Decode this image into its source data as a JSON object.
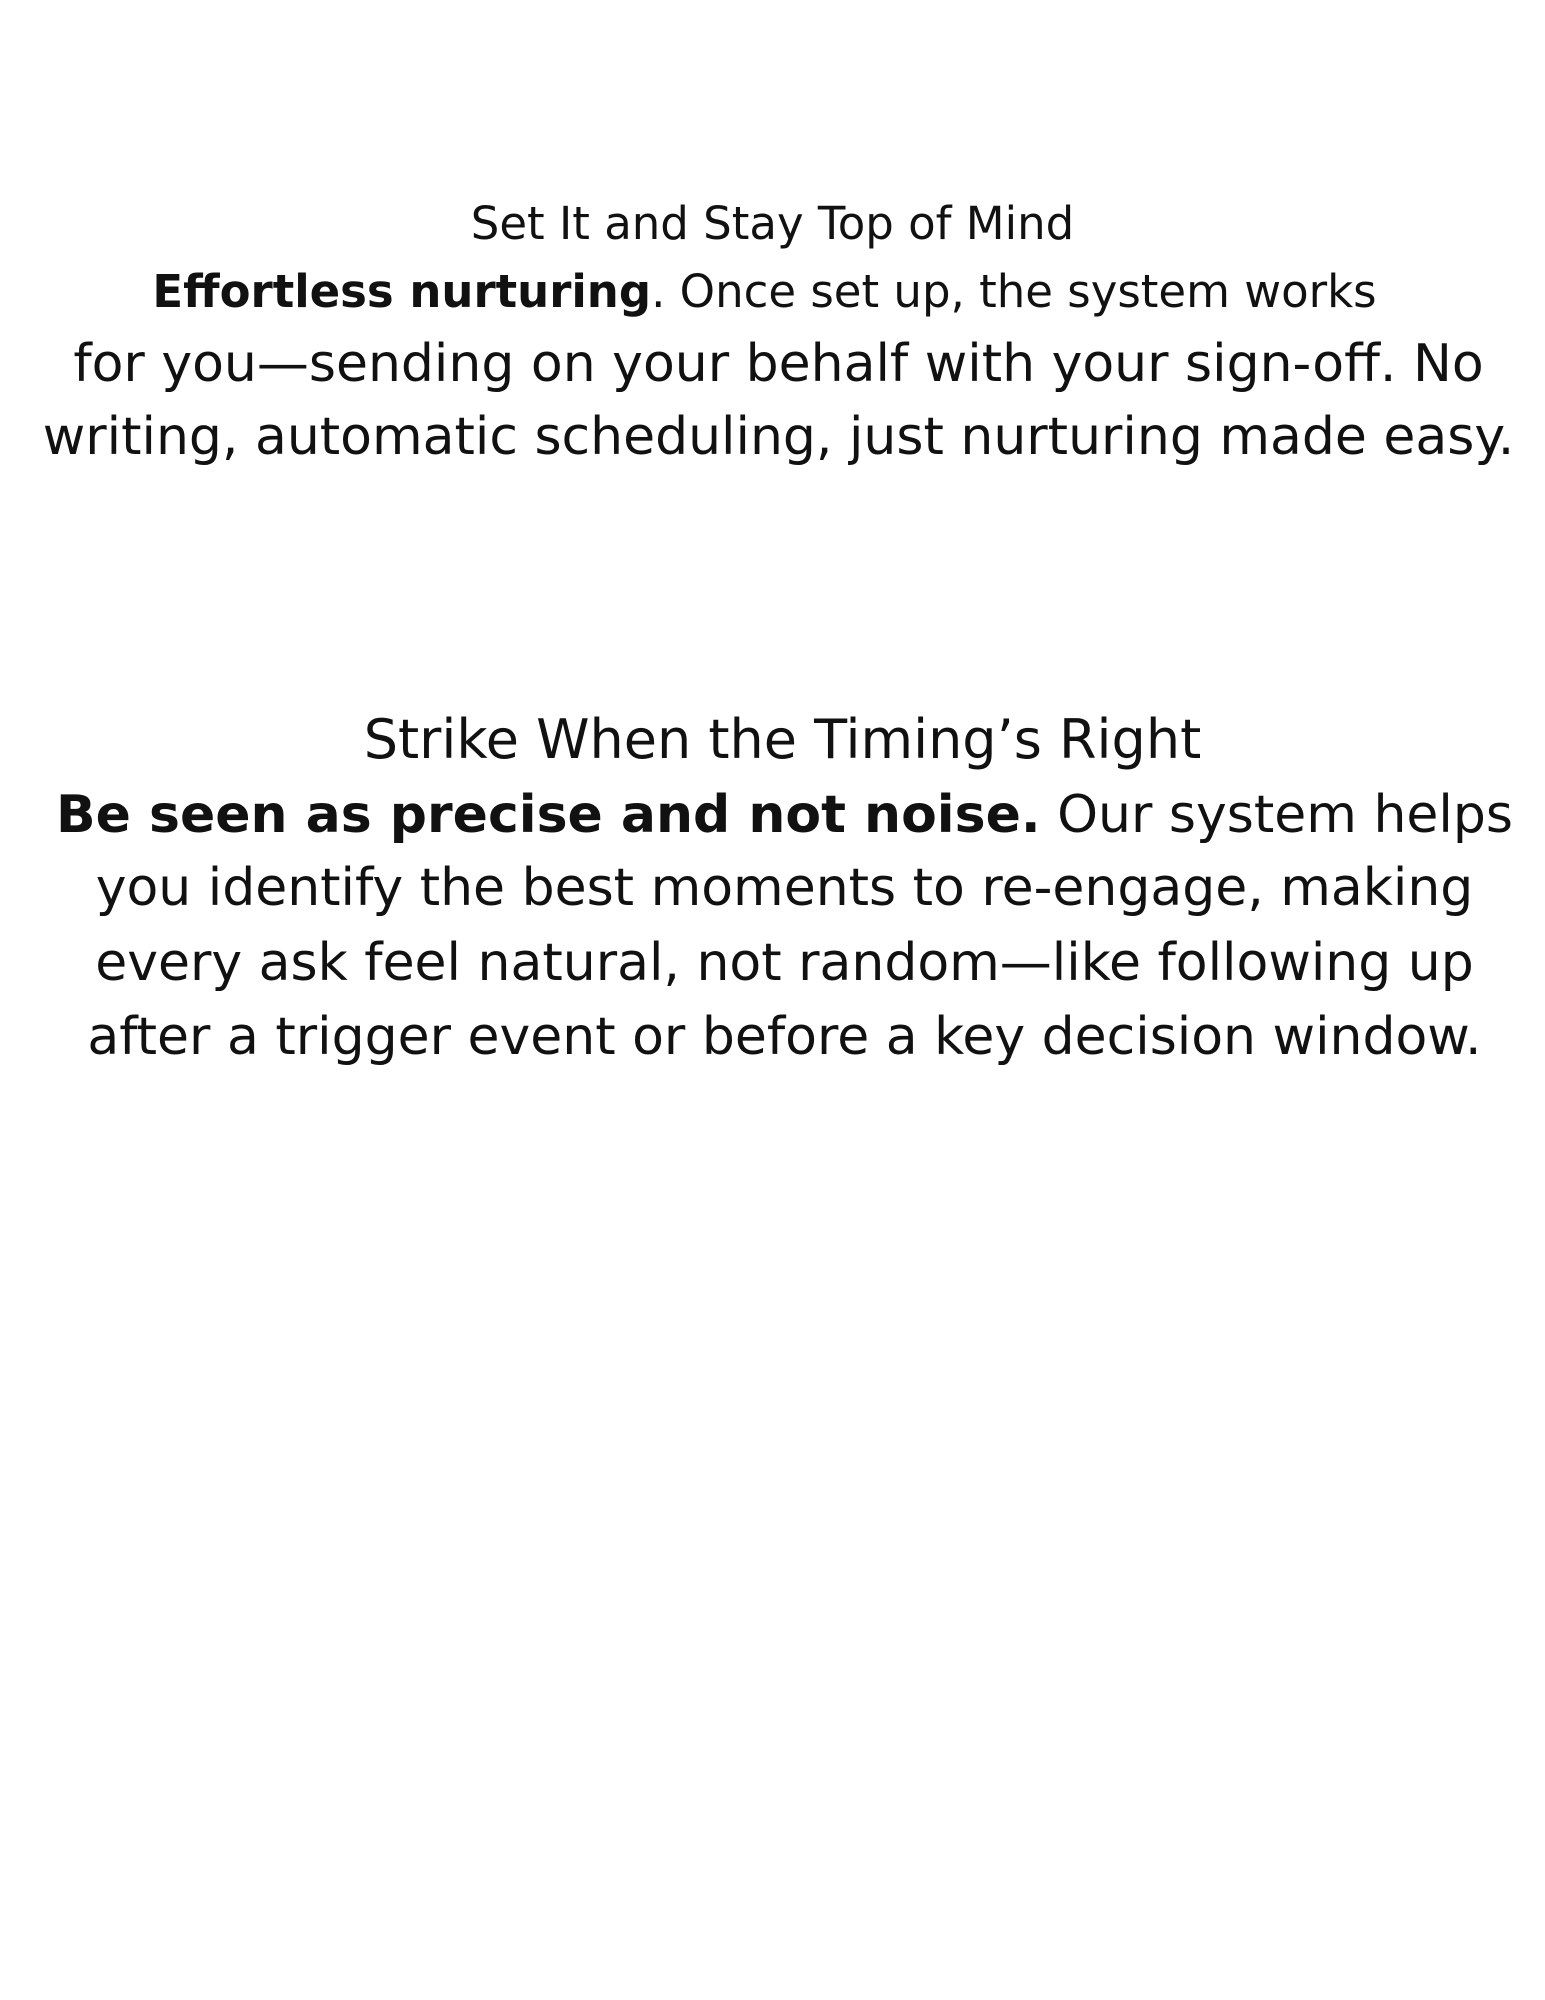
{
  "section1": {
    "title": "Set It and Stay Top of Mind",
    "line1_bold": "Effortless nurturing",
    "line1_rest": ".  Once set up, the system works",
    "line2": "for you—sending on your behalf with your sign-off. No",
    "line3": "writing, automatic scheduling, just nurturing made easy."
  },
  "section2": {
    "title": "Strike When the Timing’s Right",
    "line1_bold": "Be seen as precise and not noise.",
    "line1_rest": " Our system helps",
    "line2": "you identify the best moments to re-engage, making",
    "line3": "every ask feel natural, not random—like following up",
    "line4": "after a trigger event or before a key decision window."
  }
}
